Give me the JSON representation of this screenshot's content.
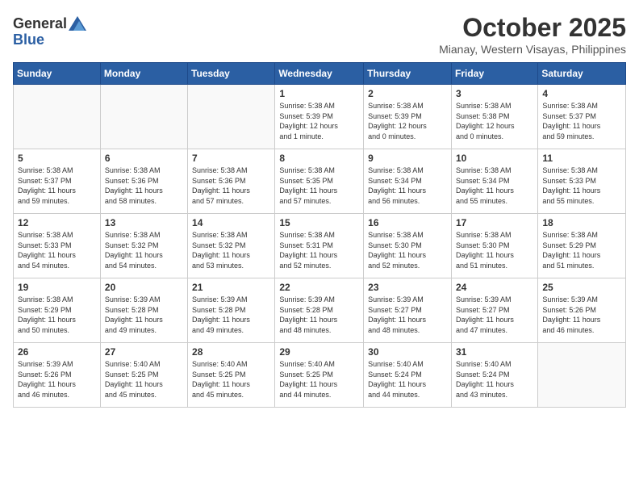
{
  "header": {
    "logo_line1": "General",
    "logo_line2": "Blue",
    "month_year": "October 2025",
    "location": "Mianay, Western Visayas, Philippines"
  },
  "weekdays": [
    "Sunday",
    "Monday",
    "Tuesday",
    "Wednesday",
    "Thursday",
    "Friday",
    "Saturday"
  ],
  "weeks": [
    [
      {
        "day": "",
        "info": ""
      },
      {
        "day": "",
        "info": ""
      },
      {
        "day": "",
        "info": ""
      },
      {
        "day": "1",
        "info": "Sunrise: 5:38 AM\nSunset: 5:39 PM\nDaylight: 12 hours\nand 1 minute."
      },
      {
        "day": "2",
        "info": "Sunrise: 5:38 AM\nSunset: 5:39 PM\nDaylight: 12 hours\nand 0 minutes."
      },
      {
        "day": "3",
        "info": "Sunrise: 5:38 AM\nSunset: 5:38 PM\nDaylight: 12 hours\nand 0 minutes."
      },
      {
        "day": "4",
        "info": "Sunrise: 5:38 AM\nSunset: 5:37 PM\nDaylight: 11 hours\nand 59 minutes."
      }
    ],
    [
      {
        "day": "5",
        "info": "Sunrise: 5:38 AM\nSunset: 5:37 PM\nDaylight: 11 hours\nand 59 minutes."
      },
      {
        "day": "6",
        "info": "Sunrise: 5:38 AM\nSunset: 5:36 PM\nDaylight: 11 hours\nand 58 minutes."
      },
      {
        "day": "7",
        "info": "Sunrise: 5:38 AM\nSunset: 5:36 PM\nDaylight: 11 hours\nand 57 minutes."
      },
      {
        "day": "8",
        "info": "Sunrise: 5:38 AM\nSunset: 5:35 PM\nDaylight: 11 hours\nand 57 minutes."
      },
      {
        "day": "9",
        "info": "Sunrise: 5:38 AM\nSunset: 5:34 PM\nDaylight: 11 hours\nand 56 minutes."
      },
      {
        "day": "10",
        "info": "Sunrise: 5:38 AM\nSunset: 5:34 PM\nDaylight: 11 hours\nand 55 minutes."
      },
      {
        "day": "11",
        "info": "Sunrise: 5:38 AM\nSunset: 5:33 PM\nDaylight: 11 hours\nand 55 minutes."
      }
    ],
    [
      {
        "day": "12",
        "info": "Sunrise: 5:38 AM\nSunset: 5:33 PM\nDaylight: 11 hours\nand 54 minutes."
      },
      {
        "day": "13",
        "info": "Sunrise: 5:38 AM\nSunset: 5:32 PM\nDaylight: 11 hours\nand 54 minutes."
      },
      {
        "day": "14",
        "info": "Sunrise: 5:38 AM\nSunset: 5:32 PM\nDaylight: 11 hours\nand 53 minutes."
      },
      {
        "day": "15",
        "info": "Sunrise: 5:38 AM\nSunset: 5:31 PM\nDaylight: 11 hours\nand 52 minutes."
      },
      {
        "day": "16",
        "info": "Sunrise: 5:38 AM\nSunset: 5:30 PM\nDaylight: 11 hours\nand 52 minutes."
      },
      {
        "day": "17",
        "info": "Sunrise: 5:38 AM\nSunset: 5:30 PM\nDaylight: 11 hours\nand 51 minutes."
      },
      {
        "day": "18",
        "info": "Sunrise: 5:38 AM\nSunset: 5:29 PM\nDaylight: 11 hours\nand 51 minutes."
      }
    ],
    [
      {
        "day": "19",
        "info": "Sunrise: 5:38 AM\nSunset: 5:29 PM\nDaylight: 11 hours\nand 50 minutes."
      },
      {
        "day": "20",
        "info": "Sunrise: 5:39 AM\nSunset: 5:28 PM\nDaylight: 11 hours\nand 49 minutes."
      },
      {
        "day": "21",
        "info": "Sunrise: 5:39 AM\nSunset: 5:28 PM\nDaylight: 11 hours\nand 49 minutes."
      },
      {
        "day": "22",
        "info": "Sunrise: 5:39 AM\nSunset: 5:28 PM\nDaylight: 11 hours\nand 48 minutes."
      },
      {
        "day": "23",
        "info": "Sunrise: 5:39 AM\nSunset: 5:27 PM\nDaylight: 11 hours\nand 48 minutes."
      },
      {
        "day": "24",
        "info": "Sunrise: 5:39 AM\nSunset: 5:27 PM\nDaylight: 11 hours\nand 47 minutes."
      },
      {
        "day": "25",
        "info": "Sunrise: 5:39 AM\nSunset: 5:26 PM\nDaylight: 11 hours\nand 46 minutes."
      }
    ],
    [
      {
        "day": "26",
        "info": "Sunrise: 5:39 AM\nSunset: 5:26 PM\nDaylight: 11 hours\nand 46 minutes."
      },
      {
        "day": "27",
        "info": "Sunrise: 5:40 AM\nSunset: 5:25 PM\nDaylight: 11 hours\nand 45 minutes."
      },
      {
        "day": "28",
        "info": "Sunrise: 5:40 AM\nSunset: 5:25 PM\nDaylight: 11 hours\nand 45 minutes."
      },
      {
        "day": "29",
        "info": "Sunrise: 5:40 AM\nSunset: 5:25 PM\nDaylight: 11 hours\nand 44 minutes."
      },
      {
        "day": "30",
        "info": "Sunrise: 5:40 AM\nSunset: 5:24 PM\nDaylight: 11 hours\nand 44 minutes."
      },
      {
        "day": "31",
        "info": "Sunrise: 5:40 AM\nSunset: 5:24 PM\nDaylight: 11 hours\nand 43 minutes."
      },
      {
        "day": "",
        "info": ""
      }
    ]
  ]
}
